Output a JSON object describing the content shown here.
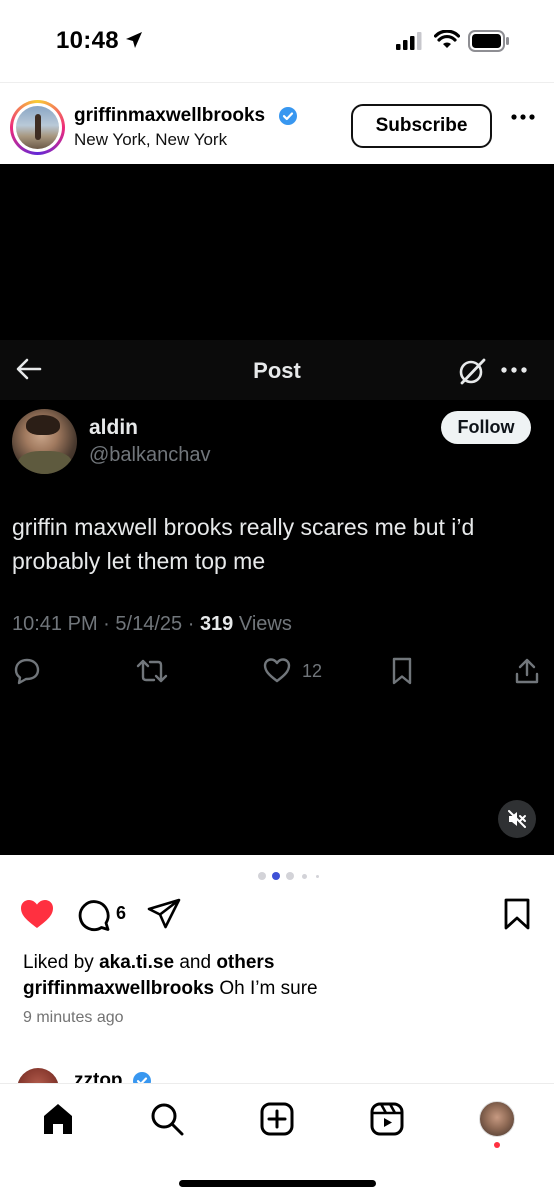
{
  "status_bar": {
    "time": "10:48"
  },
  "post": {
    "username": "griffinmaxwellbrooks",
    "location": "New York, New York",
    "subscribe_label": "Subscribe",
    "comment_count": "6",
    "liked_by_prefix": "Liked by",
    "liked_by_user": "aka.ti.se",
    "liked_by_and": "and",
    "liked_by_others": "others",
    "caption_user": "griffinmaxwellbrooks",
    "caption_text": "Oh I’m sure",
    "time_ago": "9 minutes ago",
    "carousel": {
      "count": 5,
      "active_index": 1
    }
  },
  "tweet": {
    "bar_title": "Post",
    "display_name": "aldin",
    "handle": "@balkanchav",
    "follow_label": "Follow",
    "text": "griffin maxwell brooks really scares me but i’d probably let them top me",
    "time": "10:41 PM",
    "separator": "·",
    "date": "5/14/25",
    "views_count": "319",
    "views_label": "Views",
    "like_count": "12"
  },
  "next_post": {
    "username": "zztop"
  },
  "colors": {
    "verified_blue": "#3897f0",
    "heart_red": "#ff3040",
    "active_dot": "#3f51d6",
    "tweet_text": "#e7e9ea",
    "tweet_muted": "#71767b"
  },
  "icons": {
    "status": [
      "location-arrow-icon",
      "cellular-signal-icon",
      "wifi-icon",
      "battery-icon"
    ],
    "tweet": [
      "back-arrow-icon",
      "grok-icon",
      "more-icon",
      "reply-icon",
      "retweet-icon",
      "like-icon",
      "bookmark-icon",
      "share-icon",
      "mute-icon"
    ],
    "post": [
      "heart-icon",
      "comment-icon",
      "share-icon",
      "bookmark-icon"
    ],
    "nav": [
      "home-icon",
      "search-icon",
      "create-icon",
      "reels-icon",
      "profile-avatar"
    ]
  }
}
